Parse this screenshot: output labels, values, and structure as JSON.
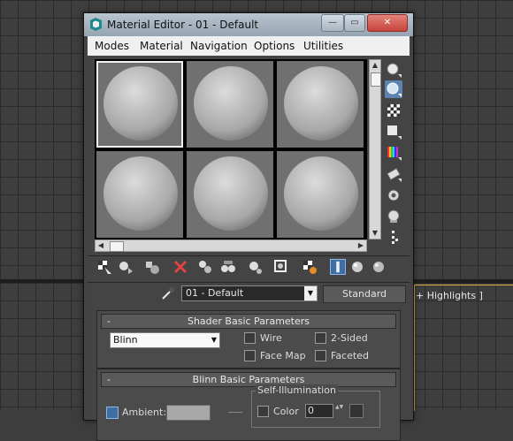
{
  "viewport": {
    "highlights_label": "+ Highlights ]"
  },
  "window": {
    "title": "Material Editor - 01 - Default",
    "controls": {
      "minimize": "—",
      "maximize": "▭",
      "close": "✕"
    }
  },
  "menu": [
    "Modes",
    "Material",
    "Navigation",
    "Options",
    "Utilities"
  ],
  "slots": {
    "count": 6,
    "active_index": 0
  },
  "scroll": {
    "up": "▲",
    "down": "▼",
    "left": "◀",
    "right": "▶"
  },
  "side_tools": [
    {
      "icon": "sample-type-icon"
    },
    {
      "icon": "backlight-icon",
      "active": true
    },
    {
      "icon": "background-checker-icon"
    },
    {
      "icon": "sample-uv-tiling-icon"
    },
    {
      "icon": "video-color-check-icon"
    },
    {
      "icon": "make-preview-icon"
    },
    {
      "icon": "options-icon"
    },
    {
      "icon": "select-by-material-icon"
    },
    {
      "icon": "material-map-navigator-icon"
    }
  ],
  "bottom_tools": [
    {
      "icon": "get-material-icon"
    },
    {
      "icon": "put-to-scene-icon"
    },
    {
      "icon": "assign-to-selection-icon"
    },
    {
      "icon": "reset-map-icon"
    },
    {
      "icon": "make-unique-icon"
    },
    {
      "icon": "put-to-library-icon"
    },
    {
      "icon": "material-id-channel-icon"
    },
    {
      "icon": "show-shaded-in-viewport-icon"
    },
    {
      "icon": "show-end-result-icon"
    },
    {
      "icon": "go-to-parent-icon",
      "active": true
    },
    {
      "icon": "go-forward-to-sibling-icon"
    },
    {
      "icon": "pick-material-icon"
    }
  ],
  "material_name": "01 - Default",
  "material_type": "Standard",
  "shader_rollout": {
    "title": "Shader Basic Parameters",
    "sign": "-",
    "shader": "Blinn",
    "options": [
      {
        "label": "Wire",
        "checked": false
      },
      {
        "label": "2-Sided",
        "checked": false
      },
      {
        "label": "Face Map",
        "checked": false
      },
      {
        "label": "Faceted",
        "checked": false
      }
    ]
  },
  "blinn_rollout": {
    "title": "Blinn Basic Parameters",
    "sign": "-",
    "ambient_label": "Ambient:",
    "self_illum_title": "Self-Illumination",
    "color_label": "Color",
    "color_value": "0",
    "spinner": "▲▼"
  },
  "colors": {
    "accent": "#5b82b0",
    "title_gradient_top": "#b9c5cf",
    "close": "#c6443a"
  }
}
